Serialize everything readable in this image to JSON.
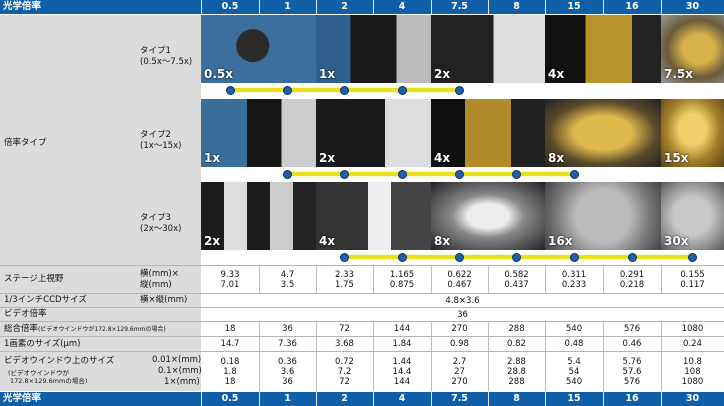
{
  "header": {
    "label": "光学倍率",
    "cols": [
      "0.5",
      "1",
      "2",
      "4",
      "7.5",
      "8",
      "15",
      "16",
      "30"
    ]
  },
  "type_label": "倍率タイプ",
  "types": [
    {
      "name": "タイプ1",
      "range": "(0.5x〜7.5x)",
      "mags": [
        "0.5x",
        "1x",
        "2x",
        "4x",
        "7.5x"
      ]
    },
    {
      "name": "タイプ2",
      "range": "(1x〜15x)",
      "mags": [
        "1x",
        "2x",
        "4x",
        "8x",
        "15x"
      ]
    },
    {
      "name": "タイプ3",
      "range": "(2x〜30x)",
      "mags": [
        "2x",
        "4x",
        "8x",
        "16x",
        "30x"
      ]
    }
  ],
  "rows": {
    "field": {
      "label": "ステージ上視野",
      "sub1": "横(mm)×",
      "sub2": "縦(mm)",
      "top": [
        "9.33",
        "4.7",
        "2.33",
        "1.165",
        "0.622",
        "0.582",
        "0.311",
        "0.291",
        "0.155"
      ],
      "bottom": [
        "7.01",
        "3.5",
        "1.75",
        "0.875",
        "0.467",
        "0.437",
        "0.233",
        "0.218",
        "0.117"
      ]
    },
    "ccd": {
      "label": "1/3インチCCDサイズ",
      "sub": "横×縦(mm)",
      "value": "4.8×3.6"
    },
    "video": {
      "label": "ビデオ倍率",
      "value": "36"
    },
    "total": {
      "label": "総合倍率",
      "note": "(ビデオウインドウが172.8×129.6mmの場合)",
      "values": [
        "18",
        "36",
        "72",
        "144",
        "270",
        "288",
        "540",
        "576",
        "1080"
      ]
    },
    "pixel": {
      "label": "1画素のサイズ(μm)",
      "values": [
        "14.7",
        "7.36",
        "3.68",
        "1.84",
        "0.98",
        "0.82",
        "0.48",
        "0.46",
        "0.24"
      ]
    },
    "window": {
      "label": "ビデオウインドウ上のサイズ",
      "note1": "(ビデオウインドウが",
      "note2": "172.8×129.6mmの場合)",
      "subs": [
        "0.01×(mm)",
        "0.1×(mm)",
        "1×(mm)"
      ],
      "r1": [
        "0.18",
        "0.36",
        "0.72",
        "1.44",
        "2.7",
        "2.88",
        "5.4",
        "5.76",
        "10.8"
      ],
      "r2": [
        "1.8",
        "3.6",
        "7.2",
        "14.4",
        "27",
        "28.8",
        "54",
        "57.6",
        "108"
      ],
      "r3": [
        "18",
        "36",
        "72",
        "144",
        "270",
        "288",
        "540",
        "576",
        "1080"
      ]
    }
  },
  "colors": {
    "header": "#0e5fa8",
    "bar": "#e6e01e",
    "dot": "#1e5fae",
    "label_bg": "#dcdcdc"
  }
}
